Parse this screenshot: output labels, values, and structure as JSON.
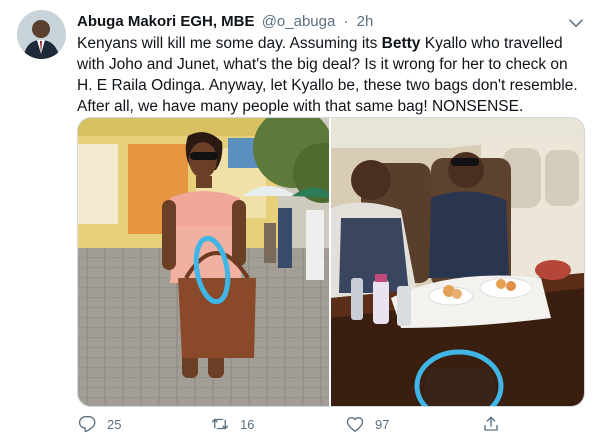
{
  "tweet": {
    "author_name": "Abuga Makori EGH, MBE",
    "handle": "@o_abuga",
    "separator": "·",
    "time": "2h",
    "text_before_bold": "Kenyans will kill me some day. Assuming its ",
    "text_bold": "Betty",
    "text_after_bold": " Kyallo who travelled with Joho and Junet, what's the big deal? Is it wrong for her to check on H. E Raila Odinga. Anyway, let Kyallo be, these two bags don't resemble. After all, we have many people with that same bag! NONSENSE."
  },
  "actions": {
    "reply_count": "25",
    "retweet_count": "16",
    "like_count": "97",
    "reply_icon": "reply-icon",
    "retweet_icon": "retweet-icon",
    "like_icon": "heart-icon",
    "share_icon": "share-icon"
  },
  "colors": {
    "text_primary": "#0f1419",
    "text_secondary": "#5b7083",
    "border": "#cfd9de",
    "circle_annotation": "#3fb6e6"
  }
}
